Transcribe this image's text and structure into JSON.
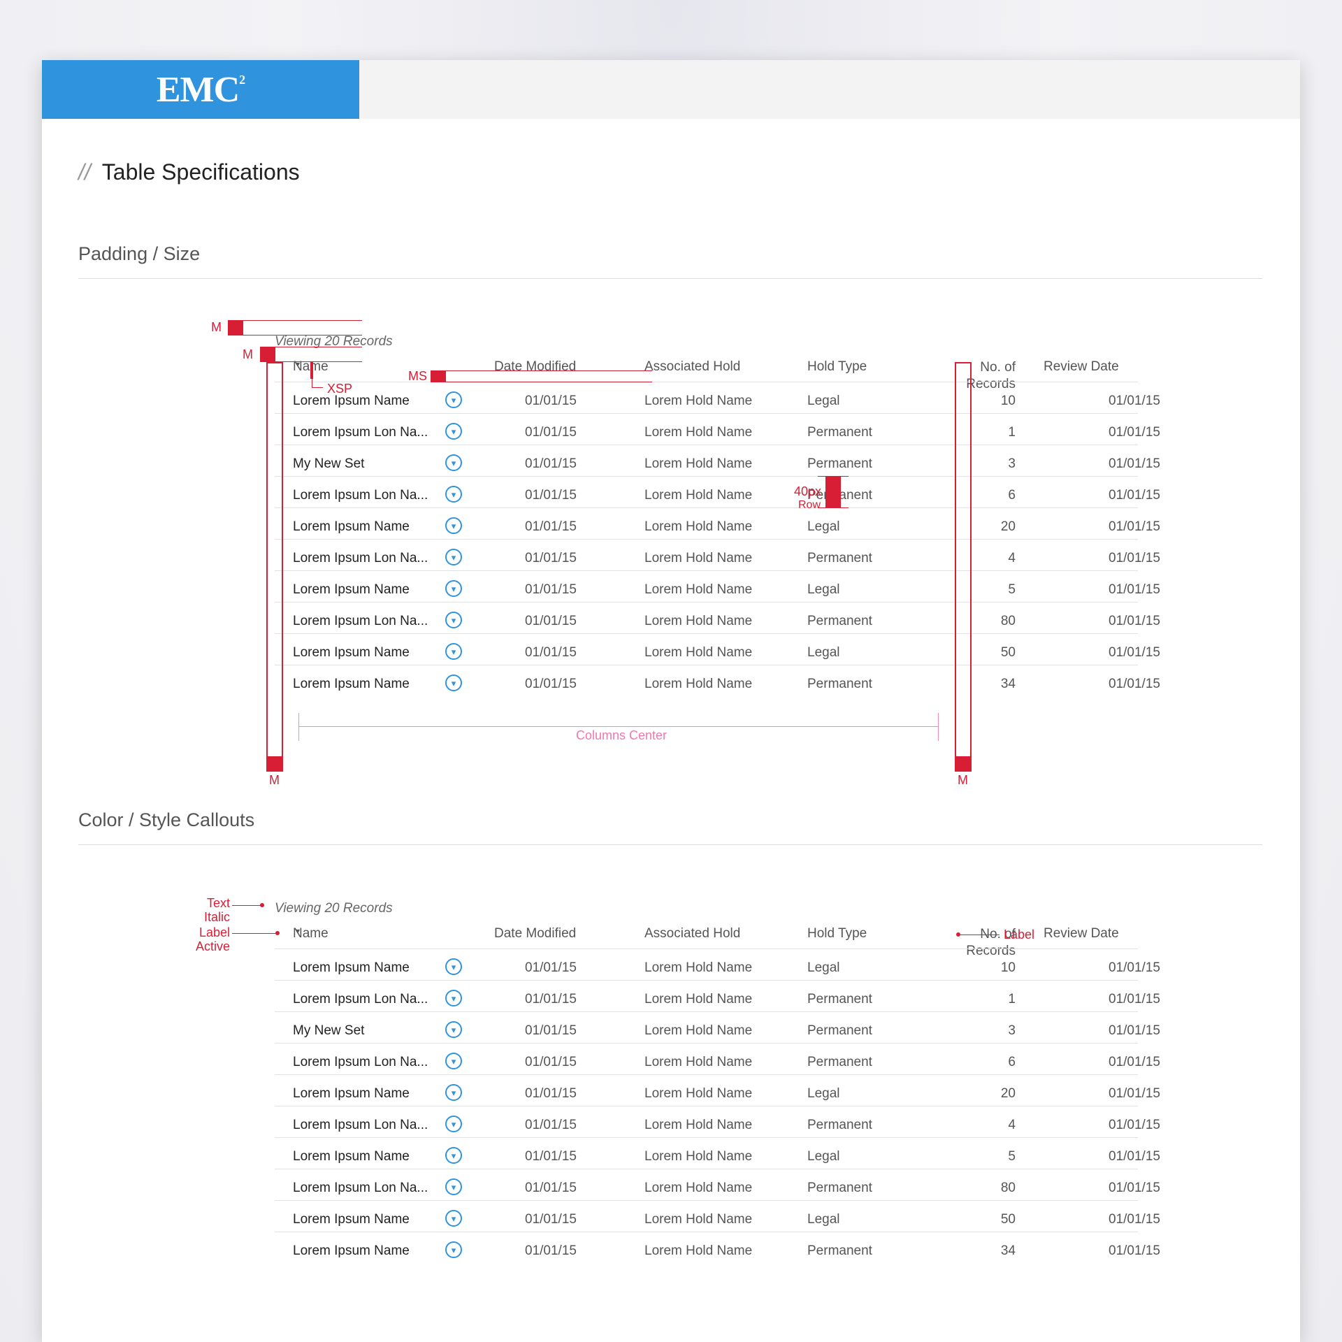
{
  "brand": {
    "logo_text": "EMC",
    "logo_sup": "2"
  },
  "page": {
    "slashes": "//",
    "title": "Table Specifications"
  },
  "sections": {
    "padding": "Padding / Size",
    "color": "Color / Style Callouts"
  },
  "table": {
    "viewing": "Viewing 20 Records",
    "headers": {
      "name": "Name",
      "date": "Date Modified",
      "hold": "Associated Hold",
      "type": "Hold Type",
      "num_line1": "No. of",
      "num_line2": "Records",
      "review": "Review Date"
    },
    "caret": "▾",
    "row_icon": "▾",
    "rows": [
      {
        "name": "Lorem Ipsum Name",
        "date": "01/01/15",
        "hold": "Lorem Hold Name",
        "type": "Legal",
        "num": "10",
        "review": "01/01/15"
      },
      {
        "name": "Lorem Ipsum Lon Na...",
        "date": "01/01/15",
        "hold": "Lorem Hold Name",
        "type": "Permanent",
        "num": "1",
        "review": "01/01/15"
      },
      {
        "name": "My New Set",
        "date": "01/01/15",
        "hold": "Lorem Hold Name",
        "type": "Permanent",
        "num": "3",
        "review": "01/01/15"
      },
      {
        "name": "Lorem Ipsum Lon Na...",
        "date": "01/01/15",
        "hold": "Lorem Hold Name",
        "type": "Permanent",
        "num": "6",
        "review": "01/01/15"
      },
      {
        "name": "Lorem Ipsum Name",
        "date": "01/01/15",
        "hold": "Lorem Hold Name",
        "type": "Legal",
        "num": "20",
        "review": "01/01/15"
      },
      {
        "name": "Lorem Ipsum Lon Na...",
        "date": "01/01/15",
        "hold": "Lorem Hold Name",
        "type": "Permanent",
        "num": "4",
        "review": "01/01/15"
      },
      {
        "name": "Lorem Ipsum Name",
        "date": "01/01/15",
        "hold": "Lorem Hold Name",
        "type": "Legal",
        "num": "5",
        "review": "01/01/15"
      },
      {
        "name": "Lorem Ipsum Lon Na...",
        "date": "01/01/15",
        "hold": "Lorem Hold Name",
        "type": "Permanent",
        "num": "80",
        "review": "01/01/15"
      },
      {
        "name": "Lorem Ipsum Name",
        "date": "01/01/15",
        "hold": "Lorem Hold Name",
        "type": "Legal",
        "num": "50",
        "review": "01/01/15"
      },
      {
        "name": "Lorem Ipsum Name",
        "date": "01/01/15",
        "hold": "Lorem Hold Name",
        "type": "Permanent",
        "num": "34",
        "review": "01/01/15"
      }
    ]
  },
  "annotations": {
    "m": "M",
    "xsp": "XSP",
    "ms": "MS",
    "row_h1": "40px",
    "row_h2": "Row",
    "columns_center": "Columns Center",
    "text_italic_1": "Text",
    "text_italic_2": "Italic",
    "label_active_1": "Label",
    "label_active_2": "Active",
    "label": "Label"
  },
  "colors": {
    "brand_blue": "#2f93de",
    "annotation_red": "#d81e35",
    "annotation_pink": "#f48ab8"
  }
}
